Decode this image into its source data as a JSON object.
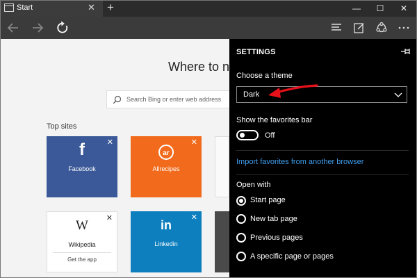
{
  "browser": {
    "tab_title": "Start",
    "tab_close": "✕",
    "new_tab": "+",
    "window_controls": {
      "minimize": "—",
      "maximize": "☐",
      "close": "✕"
    }
  },
  "icons": {
    "tab": "edge-page-icon",
    "back": "back-arrow-icon",
    "forward": "forward-arrow-icon",
    "refresh": "refresh-icon",
    "hub": "hub-icon",
    "web_note": "web-note-icon",
    "share": "share-icon",
    "more": "more-icon",
    "search": "search-icon",
    "pin": "pin-icon",
    "dropdown": "chevron-down-icon"
  },
  "start_page": {
    "heading": "Where to ne",
    "search_placeholder": "Search Bing or enter web address",
    "top_sites_label": "Top sites",
    "tiles": [
      {
        "name": "Facebook",
        "glyph": "f",
        "close": "✕",
        "color": "#3b5998"
      },
      {
        "name": "Allrecipes",
        "glyph": "ar",
        "close": "✕",
        "color": "#f26b1d"
      },
      {
        "name": "Wikipedia",
        "glyph": "W",
        "close": "✕",
        "sub": "Get the app",
        "color": "#ffffff"
      },
      {
        "name": "Linkedin",
        "glyph": "in",
        "close": "✕",
        "color": "#0d7fbf"
      }
    ]
  },
  "settings": {
    "title": "SETTINGS",
    "choose_theme_label": "Choose a theme",
    "theme_value": "Dark",
    "favorites_bar_label": "Show the favorites bar",
    "favorites_bar_state": "Off",
    "import_link": "Import favorites from another browser",
    "open_with_label": "Open with",
    "open_with_options": [
      "Start page",
      "New tab page",
      "Previous pages",
      "A specific page or pages"
    ],
    "open_with_selected": "Start page"
  },
  "colors": {
    "accent_link": "#3f9ef0",
    "annotation_arrow": "#e8101a",
    "panel_background": "#000000"
  }
}
